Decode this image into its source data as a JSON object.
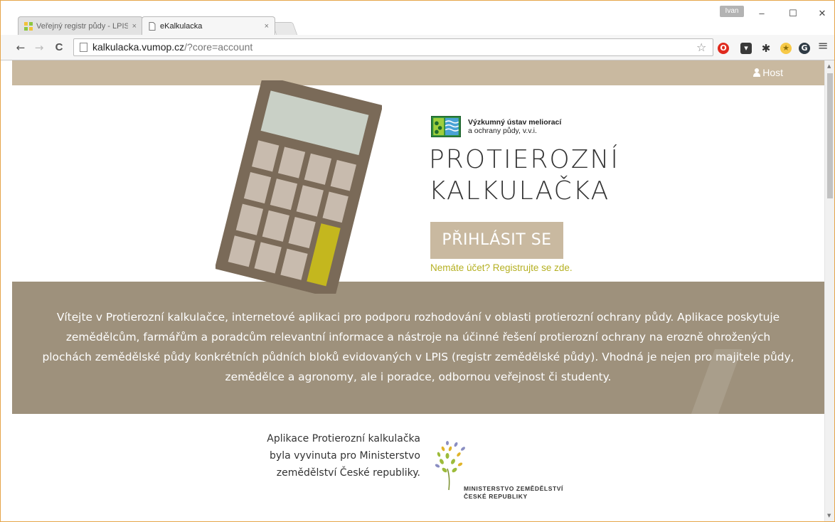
{
  "browser": {
    "tabs": [
      {
        "title": "Veřejný registr půdy - LPIS",
        "active": false
      },
      {
        "title": "eKalkulacka",
        "active": true
      }
    ],
    "tab_close": "×",
    "user_badge": "Ivan",
    "window_controls": {
      "minimize": "–",
      "maximize": "☐",
      "close": "✕"
    },
    "nav": {
      "back": "←",
      "forward": "→",
      "reload": "C"
    },
    "url": {
      "host": "kalkulacka.vumop.cz",
      "path": "/?core=account"
    },
    "bookmark_star": "☆",
    "menu": "≡",
    "colors": {
      "window_border": "#e5a54a"
    }
  },
  "page": {
    "colors": {
      "accent": "#c9b9a0",
      "band": "#9e917c",
      "link": "#b5b022",
      "calc_body": "#7a6a58"
    },
    "header": {
      "user_label": "Host"
    },
    "hero": {
      "org_line1": "Výzkumný ústav meliorací",
      "org_line2": "a ochrany půdy, v.v.i.",
      "title_line1": "PROTIEROZNÍ",
      "title_line2": "KALKULAČKA",
      "login_button": "PŘIHLÁSIT SE",
      "register_link": "Nemáte účet? Registrujte se zde."
    },
    "intro": {
      "text": "Vítejte v Protierozní kalkulačce, internetové aplikaci pro podporu rozhodování v oblasti protierozní ochrany půdy. Aplikace poskytuje zemědělcům, farmářům a poradcům relevantní informace a nástroje na účinné řešení protierozní ochrany na erozně ohrožených plochách zemědělské půdy konkrétních půdních bloků evidovaných v LPIS (registr zemědělské půdy). Vhodná je nejen pro majitele půdy, zemědělce a agronomy, ale i poradce, odbornou veřejnost či studenty."
    },
    "credit": {
      "text": "Aplikace Protierozní kalkulačka byla vyvinuta pro Ministerstvo zemědělství České republiky.",
      "logo_line1": "MINISTERSTVO ZEMĚDĚLSTVÍ",
      "logo_line2": "ČESKÉ REPUBLIKY"
    }
  }
}
